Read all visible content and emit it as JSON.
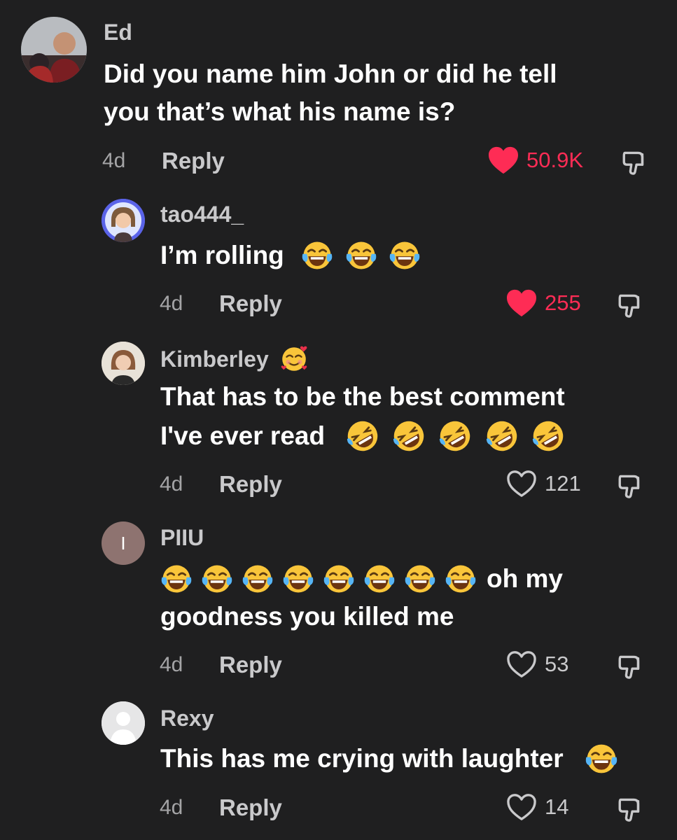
{
  "colors": {
    "background": "#1f1f20",
    "liked": "#fe2c55",
    "muted": "#c9c9cb"
  },
  "comments": [
    {
      "username": "Ed",
      "text_line1": "Did you name him John or did he tell",
      "text_line2": "you that’s what his name is?",
      "time": "4d",
      "reply_label": "Reply",
      "likes": "50.9K",
      "liked": true,
      "avatar_icon": "photo-avatar"
    },
    {
      "username": "tao444_",
      "text_line1": "I’m rolling",
      "time": "4d",
      "reply_label": "Reply",
      "likes": "255",
      "liked": true,
      "emojis": [
        "laughing-tears-emoji",
        "laughing-tears-emoji",
        "laughing-tears-emoji"
      ]
    },
    {
      "username": "Kimberley",
      "name_emoji": "smiling-hearts-emoji",
      "text_line1": "That has to be the best comment",
      "text_line2": "I've ever read",
      "time": "4d",
      "reply_label": "Reply",
      "likes": "121",
      "liked": false
    },
    {
      "username": "PIIU",
      "avatar_letter": "I",
      "text_line1": "oh my",
      "text_line2": "goodness you killed me",
      "time": "4d",
      "reply_label": "Reply",
      "likes": "53",
      "liked": false
    },
    {
      "username": "Rexy",
      "text_line1": "This has me crying with laughter",
      "time": "4d",
      "reply_label": "Reply",
      "likes": "14",
      "liked": false
    }
  ]
}
